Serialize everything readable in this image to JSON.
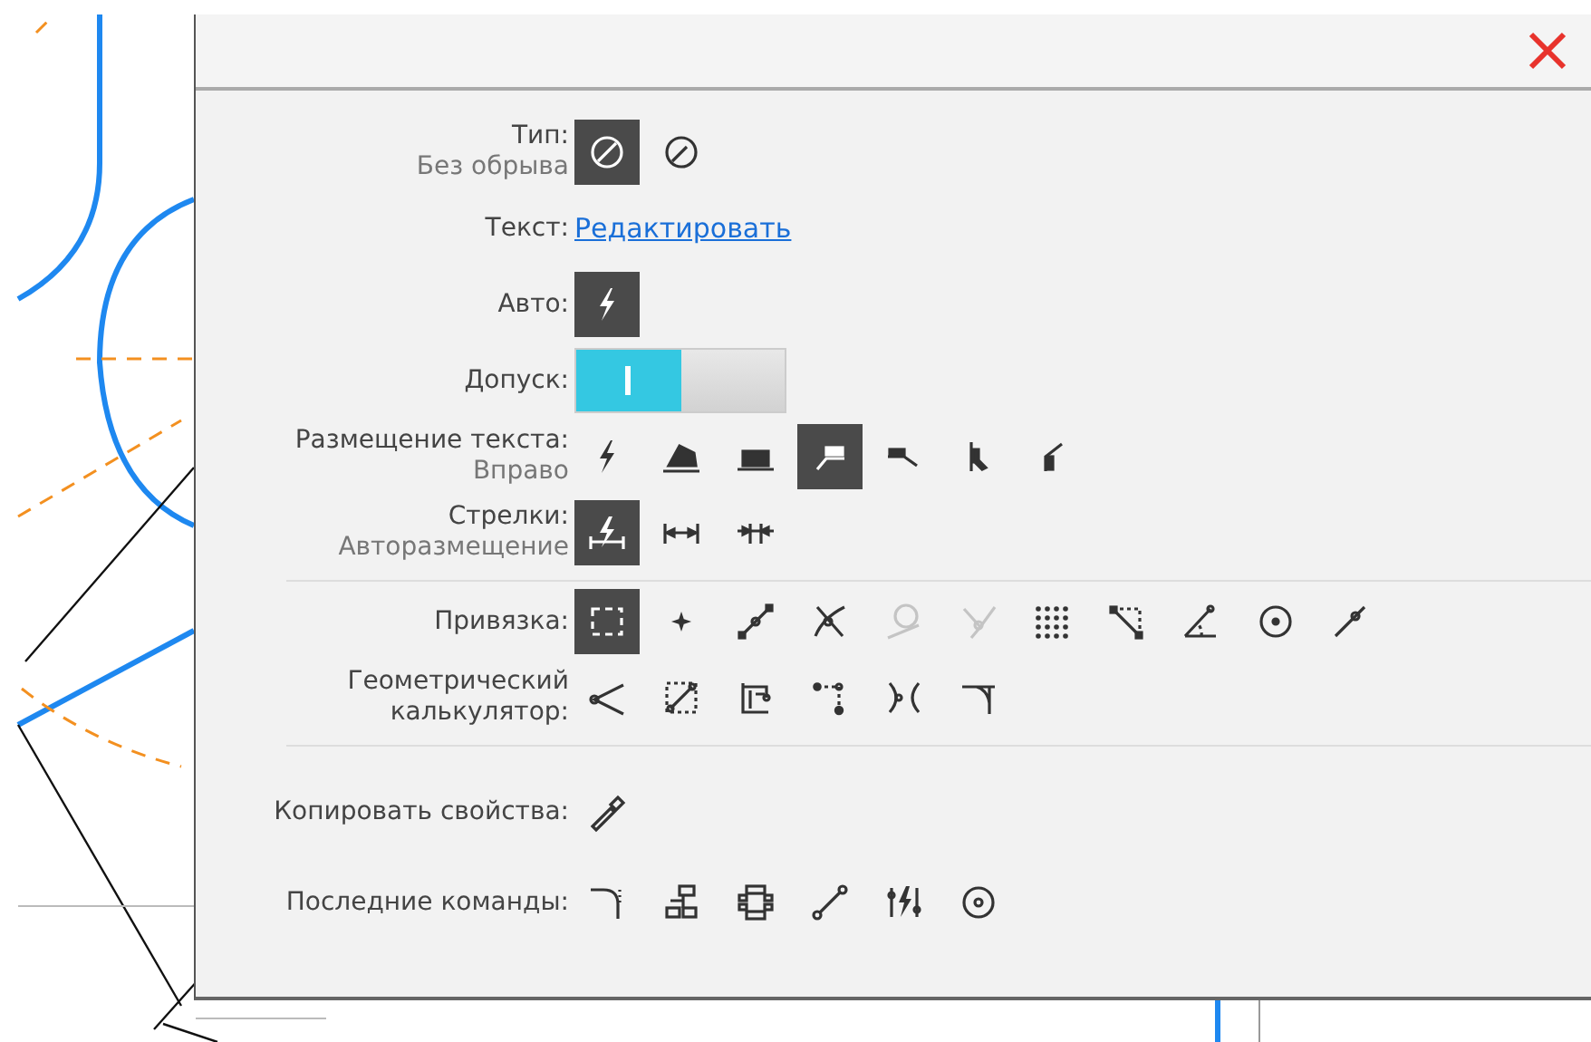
{
  "panel": {
    "sections": [
      [
        {
          "kind": "options",
          "label": "Тип:",
          "value": "Без обрыва",
          "options": [
            {
              "selected": true
            },
            {
              "selected": false
            }
          ]
        },
        {
          "kind": "link",
          "label": "Текст:",
          "link": "Редактировать"
        },
        {
          "kind": "options",
          "label": "Авто:",
          "options": [
            {
              "selected": true
            }
          ]
        },
        {
          "kind": "toggle",
          "label": "Допуск:",
          "on": true
        },
        {
          "kind": "options",
          "label": "Размещение текста:",
          "value": "Вправо",
          "options": [
            {
              "selected": false
            },
            {
              "selected": false
            },
            {
              "selected": false
            },
            {
              "selected": true
            },
            {
              "selected": false
            },
            {
              "selected": false
            },
            {
              "selected": false
            }
          ]
        },
        {
          "kind": "options",
          "label": "Стрелки:",
          "value": "Авторазмещение",
          "options": [
            {
              "selected": true
            },
            {
              "selected": false
            },
            {
              "selected": false
            }
          ]
        }
      ],
      [
        {
          "kind": "options",
          "label": "Привязка:",
          "options": [
            {
              "selected": true,
              "disabled": false
            },
            {
              "selected": false,
              "disabled": false
            },
            {
              "selected": false,
              "disabled": false
            },
            {
              "selected": false,
              "disabled": false
            },
            {
              "selected": false,
              "disabled": true
            },
            {
              "selected": false,
              "disabled": true
            },
            {
              "selected": false,
              "disabled": false
            },
            {
              "selected": false,
              "disabled": false
            },
            {
              "selected": false,
              "disabled": false
            },
            {
              "selected": false,
              "disabled": false
            },
            {
              "selected": false,
              "disabled": false
            }
          ]
        },
        {
          "kind": "commands",
          "label": "Геометрический калькулятор:"
        }
      ],
      [
        {
          "kind": "commands",
          "label": "Копировать свойства:"
        },
        {
          "kind": "commands",
          "label": "Последние команды:"
        }
      ]
    ]
  }
}
